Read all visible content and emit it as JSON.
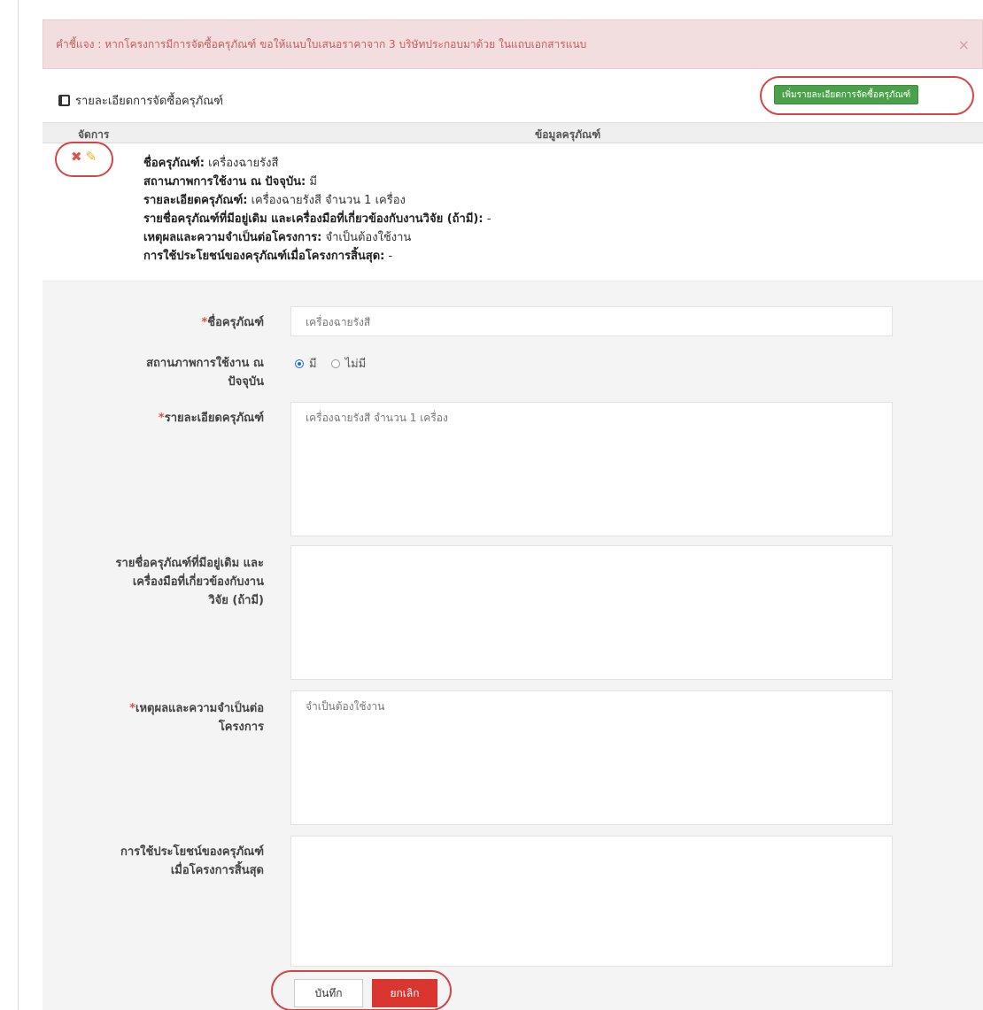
{
  "alert": {
    "text": "คำชี้แจง : หากโครงการมีการจัดซื้อครุภัณฑ์ ขอให้แนบใบเสนอราคาจาก 3 บริษัทประกอบมาด้วย ในแถบเอกสารแนบ",
    "close": "×"
  },
  "panel": {
    "title": "รายละเอียดการจัดซื้อครุภัณฑ์",
    "add_button": "เพิ่มรายละเอียดการจัดซื้อครุภัณฑ์"
  },
  "table": {
    "col_manage": "จัดการ",
    "col_info": "ข้อมูลครุภัณฑ์"
  },
  "row": {
    "name_label": "ชื่อครุภัณฑ์:",
    "name_value": "เครื่องฉายรังสี",
    "status_label": "สถานภาพการใช้งาน ณ ปัจจุบัน:",
    "status_value": "มี",
    "detail_label": "รายละเอียดครุภัณฑ์:",
    "detail_value": "เครื่องฉายรังสี จำนวน 1 เครื่อง",
    "existing_label": "รายชื่อครุภัณฑ์ที่มีอยู่เดิม และเครื่องมือที่เกี่ยวข้องกับงานวิจัย (ถ้ามี):",
    "existing_value": "-",
    "reason_label": "เหตุผลและความจำเป็นต่อโครงการ:",
    "reason_value": "จำเป็นต้องใช้งาน",
    "benefit_label": "การใช้ประโยชน์ของครุภัณฑ์เมื่อโครงการสิ้นสุด:",
    "benefit_value": "-"
  },
  "form": {
    "name_label": "ชื่อครุภัณฑ์",
    "name_value": "เครื่องฉายรังสี",
    "status_label_1": "สถานภาพการใช้งาน ณ",
    "status_label_2": "ปัจจุบัน",
    "radio_yes": "มี",
    "radio_no": "ไม่มี",
    "detail_label": "รายละเอียดครุภัณฑ์",
    "detail_value": "เครื่องฉายรังสี จำนวน 1 เครื่อง",
    "existing_label_1": "รายชื่อครุภัณฑ์ที่มีอยู่เดิม และ",
    "existing_label_2": "เครื่องมือที่เกี่ยวข้องกับงาน",
    "existing_label_3": "วิจัย (ถ้ามี)",
    "existing_value": "",
    "reason_label_1": "เหตุผลและความจำเป็นต่อ",
    "reason_label_2": "โครงการ",
    "reason_value": "จำเป็นต้องใช้งาน",
    "benefit_label_1": "การใช้ประโยชน์ของครุภัณฑ์",
    "benefit_label_2": "เมื่อโครงการสิ้นสุด",
    "benefit_value": "",
    "save": "บันทึก",
    "cancel": "ยกเลิก"
  }
}
